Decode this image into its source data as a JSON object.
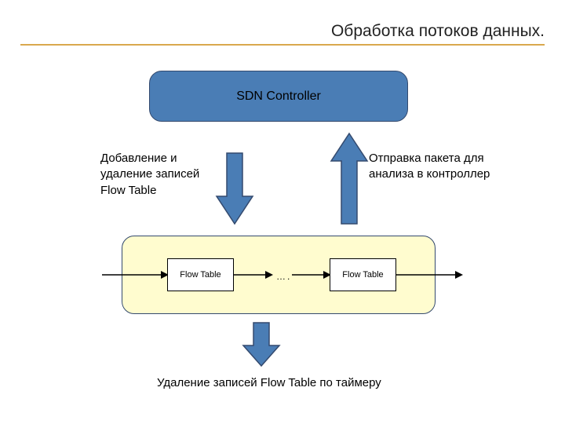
{
  "title": "Обработка потоков данных.",
  "controller": {
    "label": "SDN Controller"
  },
  "pipeline": {
    "flow_table_label_1": "Flow Table",
    "flow_table_label_2": "Flow Table",
    "ellipsis": "…."
  },
  "labels": {
    "add_remove": "Добавление и удаление записей Flow Table",
    "send_packet": "Отправка пакета для анализа в контроллер",
    "timer_remove": "Удаление записей Flow Table по таймеру"
  },
  "colors": {
    "arrow_fill": "#4a7db5",
    "arrow_stroke": "#344a6e"
  }
}
